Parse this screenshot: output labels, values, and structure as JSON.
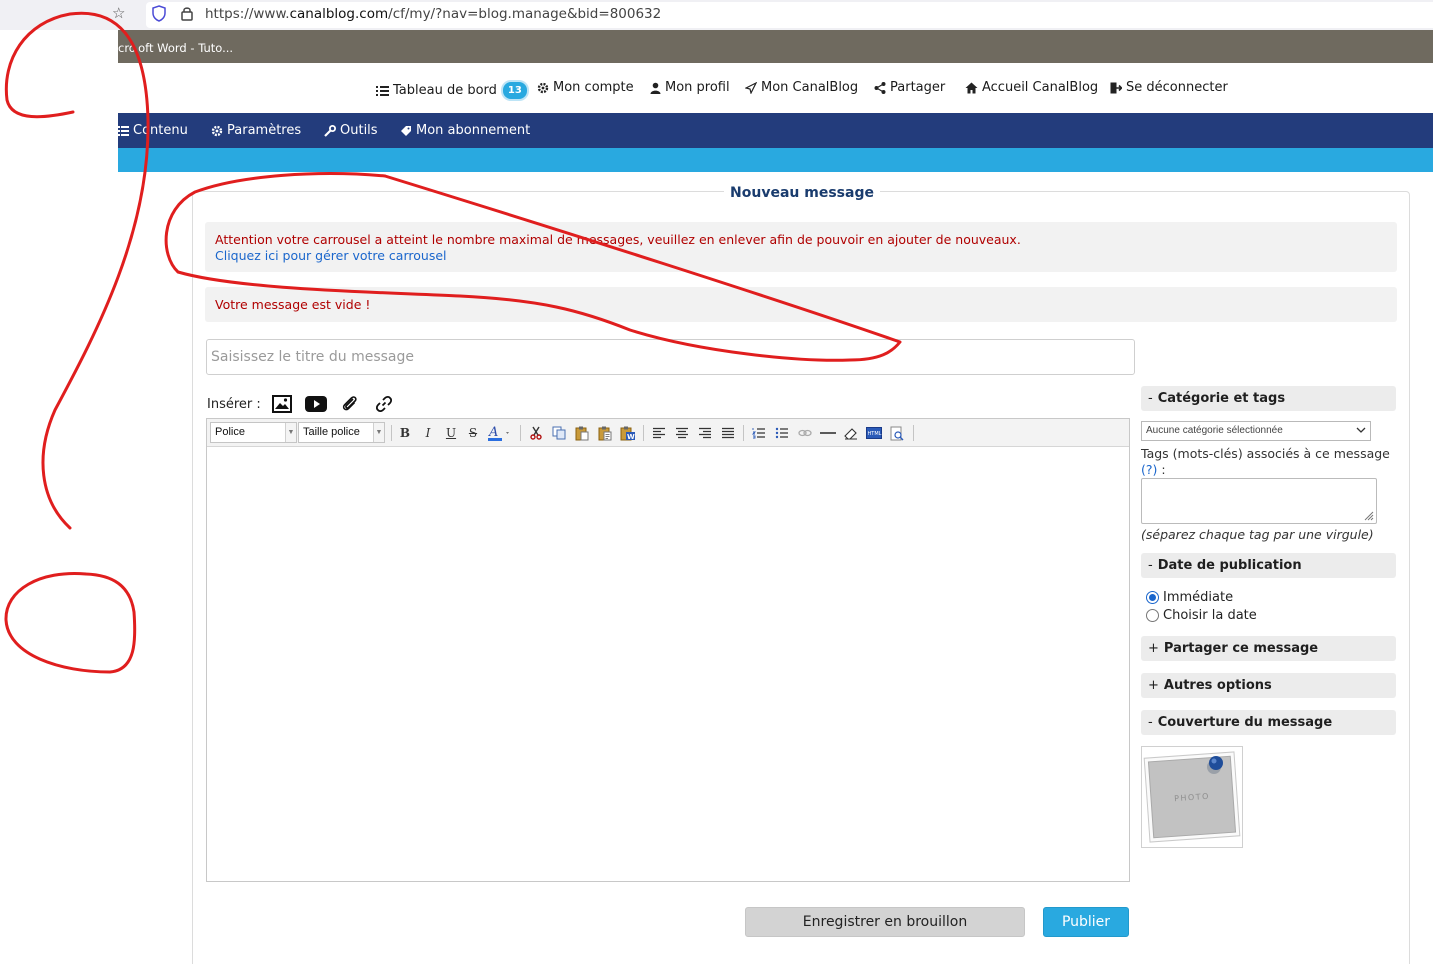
{
  "browser": {
    "url_prefix": "https://www.",
    "url_domain": "canalblog.com",
    "url_path": "/cf/my/?nav=blog.manage&bid=800632",
    "bookmark": "cro oft Word - Tuto..."
  },
  "topnav": {
    "dashboard": "Tableau de bord",
    "dashboard_badge": "13",
    "account": "Mon compte",
    "profile": "Mon profil",
    "my_canalblog": "Mon CanalBlog",
    "share": "Partager",
    "home": "Accueil CanalBlog",
    "logout": "Se déconnecter"
  },
  "mainmenu": {
    "content": "Contenu",
    "settings": "Paramètres",
    "tools": "Outils",
    "subscription": "Mon abonnement"
  },
  "panel": {
    "title": "Nouveau message",
    "alert_carousel": "Attention votre carrousel a atteint le nombre maximal de messages, veuillez en enlever afin de pouvoir en ajouter de nouveaux.",
    "alert_carousel_link": "Cliquez ici pour gérer votre carrousel",
    "alert_empty": "Votre message est vide !",
    "title_placeholder": "Saisissez le titre du message",
    "insert_label": "Insérer :"
  },
  "editor": {
    "font_select": "Police",
    "size_select": "Taille police"
  },
  "sidebar": {
    "categories_header": "Catégorie et tags",
    "categories_sign": "-",
    "category_select": "Aucune catégorie sélectionnée",
    "tags_label": "Tags (mots-clés) associés à ce message",
    "tags_help": "(?)",
    "tags_colon": " :",
    "tags_hint": "(séparez chaque tag par une virgule)",
    "date_header": "Date de publication",
    "date_sign": "-",
    "radio_immediate": "Immédiate",
    "radio_choose": "Choisir la date",
    "share_header": "Partager ce message",
    "share_sign": "+",
    "other_header": "Autres options",
    "other_sign": "+",
    "cover_header": "Couverture du message",
    "cover_sign": "-",
    "cover_photo_text": "PHOTO"
  },
  "buttons": {
    "draft": "Enregistrer en brouillon",
    "publish": "Publier"
  },
  "colors": {
    "menu_bg": "#233c7c",
    "accent": "#29a9e0",
    "error": "#b00000",
    "link": "#1a66cc",
    "annotation": "#e01e1e"
  }
}
